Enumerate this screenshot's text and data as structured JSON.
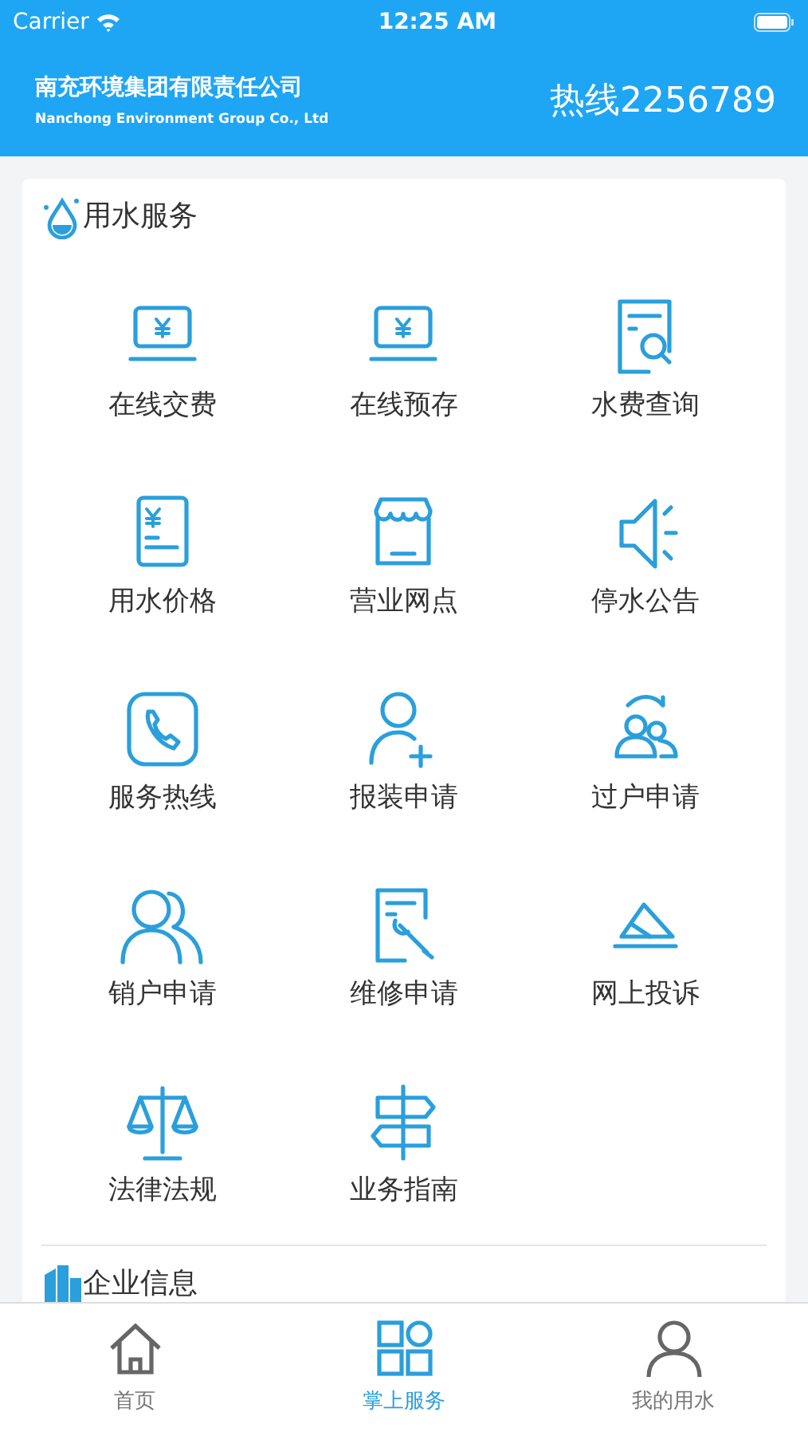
{
  "status_bar": {
    "carrier": "Carrier",
    "time": "12:25 AM"
  },
  "header": {
    "company": "南充环境集团有限责任公司",
    "company_en": "Nanchong Environment Group Co., Ltd",
    "hotline": "热线2256789"
  },
  "sections": [
    {
      "title": "用水服务",
      "kind": "drop",
      "items": [
        {
          "label": "在线交费",
          "kind": "laptop-yen"
        },
        {
          "label": "在线预存",
          "kind": "laptop-yen"
        },
        {
          "label": "水费查询",
          "kind": "doc-search"
        },
        {
          "label": "用水价格",
          "kind": "doc-yen"
        },
        {
          "label": "营业网点",
          "kind": "store"
        },
        {
          "label": "停水公告",
          "kind": "speaker"
        },
        {
          "label": "服务热线",
          "kind": "phone"
        },
        {
          "label": "报装申请",
          "kind": "user-plus"
        },
        {
          "label": "过户申请",
          "kind": "users-swap"
        },
        {
          "label": "销户申请",
          "kind": "users"
        },
        {
          "label": "维修申请",
          "kind": "doc-wrench"
        },
        {
          "label": "网上投诉",
          "kind": "envelope"
        },
        {
          "label": "法律法规",
          "kind": "scales"
        },
        {
          "label": "业务指南",
          "kind": "signpost"
        }
      ]
    },
    {
      "title": "企业信息",
      "kind": "building"
    }
  ],
  "tab_bar": [
    {
      "label": "首页",
      "kind": "home",
      "selected": false
    },
    {
      "label": "掌上服务",
      "kind": "grid",
      "selected": true
    },
    {
      "label": "我的用水",
      "kind": "person",
      "selected": false
    }
  ]
}
